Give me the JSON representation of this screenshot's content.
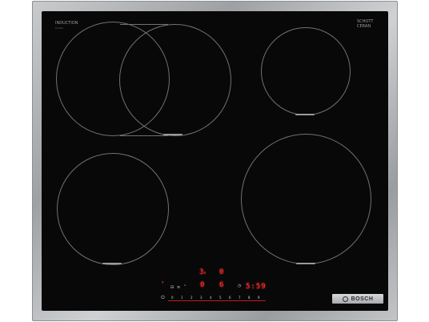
{
  "product": {
    "type_label": "INDUCTION",
    "type_sublabel": "Combi",
    "glass_brand_top": "SCHOTT",
    "glass_brand_bottom": "CERAN",
    "brand": "BOSCH"
  },
  "display": {
    "zone_level_left_top": "3",
    "zone_level_left_top_suffix": "s",
    "zone_level_right_top": "0",
    "zone_level_left_bottom": "0",
    "zone_level_right_bottom": "6",
    "timer_readout": "5:59"
  },
  "slider": {
    "values": [
      "0",
      "1",
      "2",
      "3",
      "4",
      "5",
      "6",
      "7",
      "8",
      "9"
    ]
  },
  "icons": {
    "power": "power-icon",
    "timer": "timer-icon",
    "lock": "child-lock-icon",
    "flex": "flex-zone-icon",
    "boost": "boost-icon"
  },
  "colors": {
    "glass": "#080808",
    "frame": "#b5b8bb",
    "display_red": "#ff2a2a",
    "zone_outline": "#6f7173"
  }
}
